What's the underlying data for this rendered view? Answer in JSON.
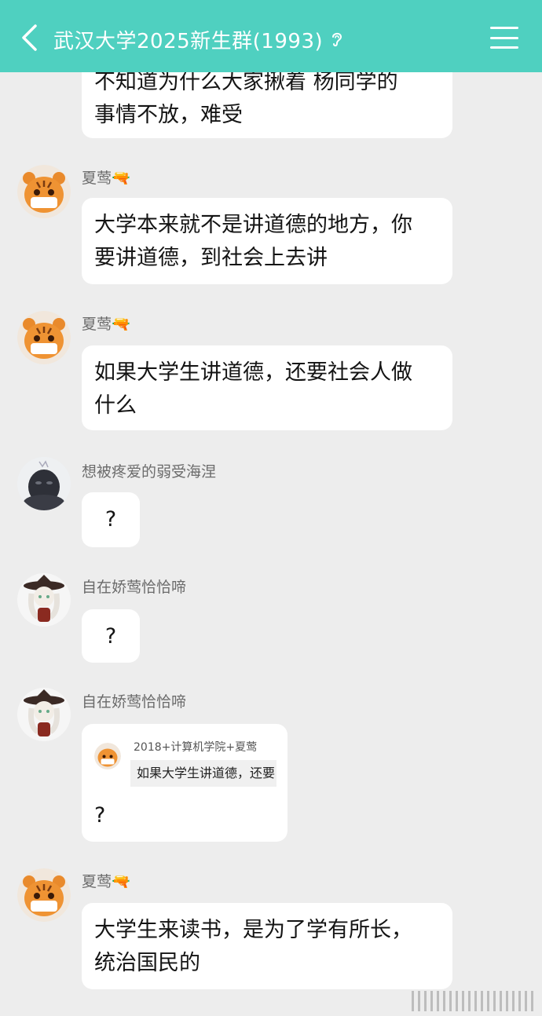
{
  "header": {
    "title": "武汉大学2025新生群(1993)",
    "back_icon": "chevron-left-icon",
    "ear_icon": "ear-icon",
    "menu_icon": "hamburger-menu-icon",
    "color": "#4fd0c0"
  },
  "messages": [
    {
      "sender": "",
      "text_lines": [
        "不知道为什么大家揪着 杨同学的",
        "事情不放，难受"
      ]
    },
    {
      "sender": "夏莺🔫",
      "text_lines": [
        "大学本来就不是讲道德的地方，你",
        "要讲道德，到社会上去讲"
      ]
    },
    {
      "sender": "夏莺🔫",
      "text_lines": [
        "如果大学生讲道德，还要社会人做",
        "什么"
      ]
    },
    {
      "sender": "想被疼爱的弱受海涅",
      "text_lines": [
        "?"
      ]
    },
    {
      "sender": "自在娇莺恰恰啼",
      "text_lines": [
        "?"
      ]
    },
    {
      "sender": "自在娇莺恰恰啼",
      "quote": {
        "name": "2018+计算机学院+夏莺",
        "text": "如果大学生讲道德，还要"
      },
      "text_lines": [
        "?"
      ]
    },
    {
      "sender": "夏莺🔫",
      "text_lines": [
        "大学生来读书，是为了学有所长，",
        "统治国民的"
      ]
    }
  ]
}
